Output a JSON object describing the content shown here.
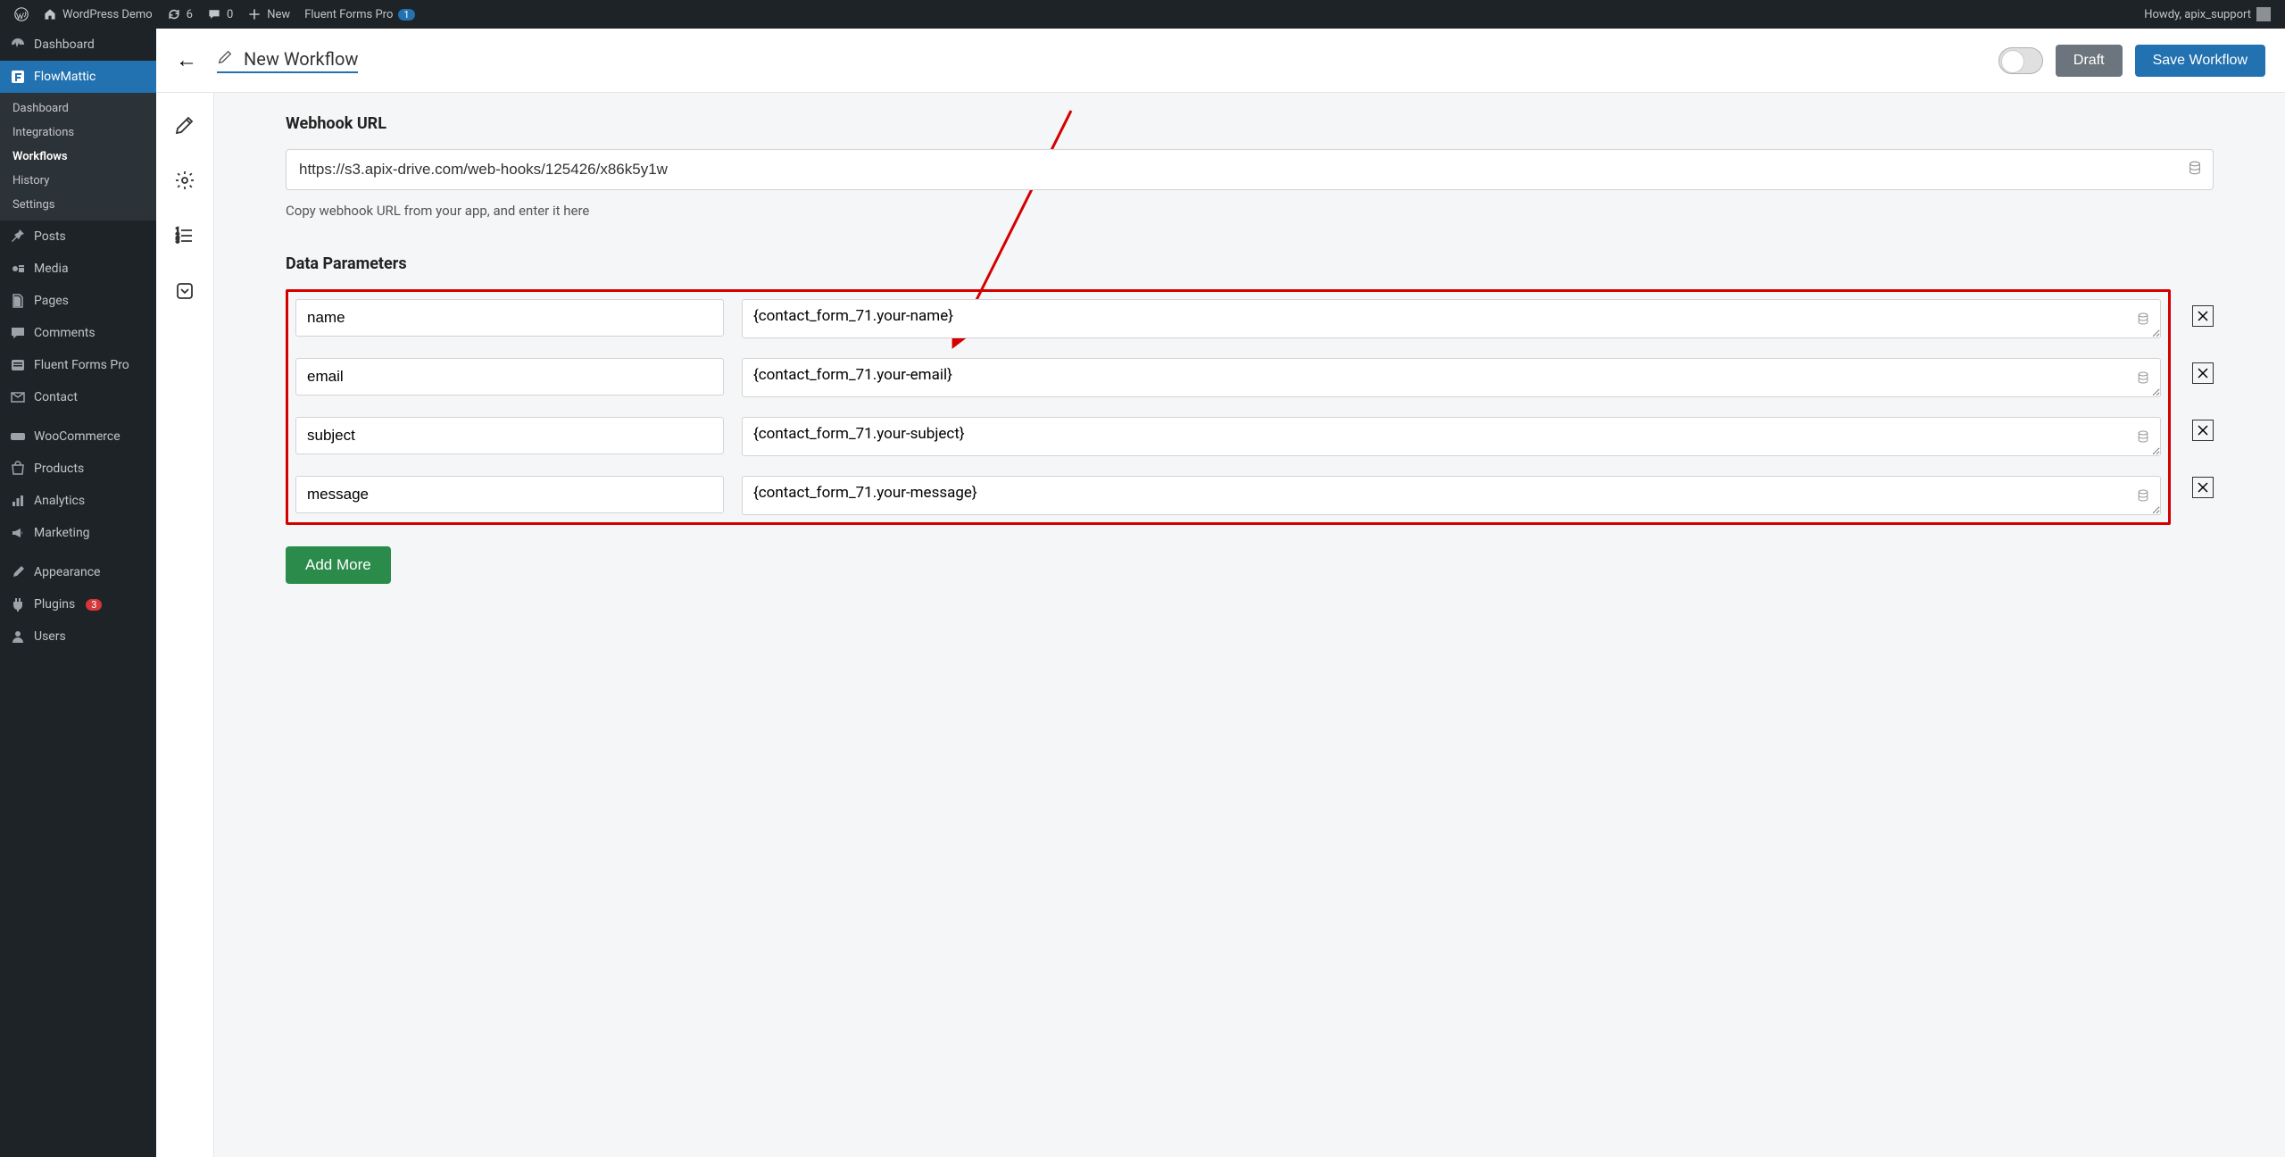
{
  "adminbar": {
    "site_name": "WordPress Demo",
    "updates": "6",
    "comments": "0",
    "new_label": "New",
    "fluent_label": "Fluent Forms Pro",
    "fluent_count": "1",
    "howdy": "Howdy, apix_support"
  },
  "sidebar": {
    "dashboard": "Dashboard",
    "flowmattic": "FlowMattic",
    "submenu": {
      "dashboard": "Dashboard",
      "integrations": "Integrations",
      "workflows": "Workflows",
      "history": "History",
      "settings": "Settings"
    },
    "posts": "Posts",
    "media": "Media",
    "pages": "Pages",
    "comments": "Comments",
    "fluent": "Fluent Forms Pro",
    "contact": "Contact",
    "woo": "WooCommerce",
    "products": "Products",
    "analytics": "Analytics",
    "marketing": "Marketing",
    "appearance": "Appearance",
    "plugins": "Plugins",
    "plugins_count": "3",
    "users": "Users"
  },
  "header": {
    "title": "New Workflow",
    "draft": "Draft",
    "save": "Save Workflow"
  },
  "webhook": {
    "title": "Webhook URL",
    "url": "https://s3.apix-drive.com/web-hooks/125426/x86k5y1w",
    "help": "Copy webhook URL from your app, and enter it here"
  },
  "params": {
    "title": "Data Parameters",
    "rows": [
      {
        "key": "name",
        "value": "{contact_form_71.your-name}"
      },
      {
        "key": "email",
        "value": "{contact_form_71.your-email}"
      },
      {
        "key": "subject",
        "value": "{contact_form_71.your-subject}"
      },
      {
        "key": "message",
        "value": "{contact_form_71.your-message}"
      }
    ],
    "add_more": "Add More"
  }
}
